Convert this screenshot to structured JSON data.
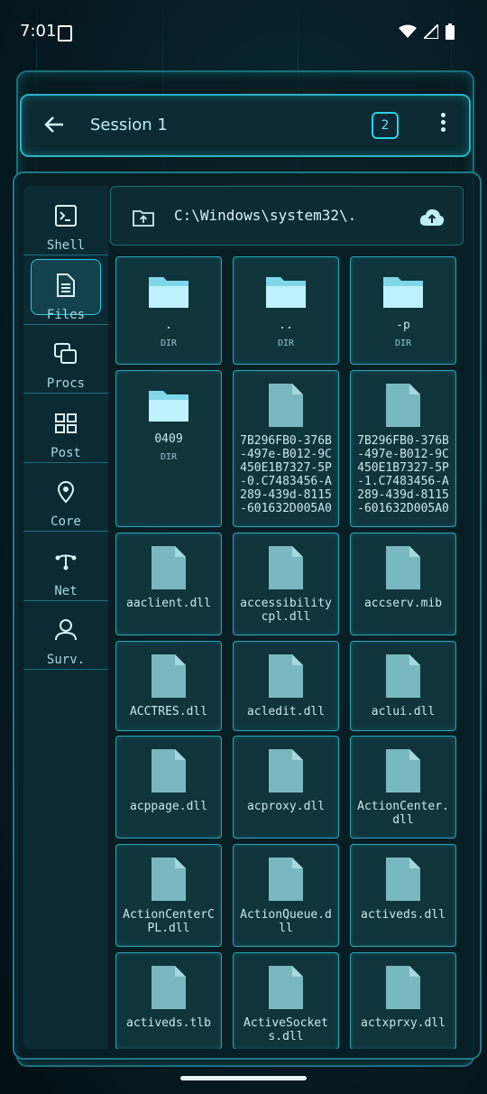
{
  "status": {
    "time": "7:01"
  },
  "header": {
    "title": "Session 1",
    "badge": "2"
  },
  "sidebar": [
    {
      "label": "Shell",
      "icon": "terminal-icon",
      "active": false
    },
    {
      "label": "Files",
      "icon": "document-icon",
      "active": true
    },
    {
      "label": "Procs",
      "icon": "processes-icon",
      "active": false
    },
    {
      "label": "Post",
      "icon": "grid-icon",
      "active": false
    },
    {
      "label": "Core",
      "icon": "location-pin-icon",
      "active": false
    },
    {
      "label": "Net",
      "icon": "network-icon",
      "active": false
    },
    {
      "label": "Surv.",
      "icon": "person-icon",
      "active": false
    }
  ],
  "path": {
    "value": "C:\\Windows\\system32\\."
  },
  "files": [
    {
      "name": ".",
      "kind": "DIR",
      "type": "folder"
    },
    {
      "name": "..",
      "kind": "DIR",
      "type": "folder"
    },
    {
      "name": "-p",
      "kind": "DIR",
      "type": "folder"
    },
    {
      "name": "0409",
      "kind": "DIR",
      "type": "folder"
    },
    {
      "name": "7B296FB0-376B-497e-B012-9C450E1B7327-5P-0.C7483456-A289-439d-8115-601632D005A0",
      "kind": "",
      "type": "file"
    },
    {
      "name": "7B296FB0-376B-497e-B012-9C450E1B7327-5P-1.C7483456-A289-439d-8115-601632D005A0",
      "kind": "",
      "type": "file"
    },
    {
      "name": "aaclient.dll",
      "kind": "",
      "type": "file"
    },
    {
      "name": "accessibilitycpl.dll",
      "kind": "",
      "type": "file"
    },
    {
      "name": "accserv.mib",
      "kind": "",
      "type": "file"
    },
    {
      "name": "ACCTRES.dll",
      "kind": "",
      "type": "file"
    },
    {
      "name": "acledit.dll",
      "kind": "",
      "type": "file"
    },
    {
      "name": "aclui.dll",
      "kind": "",
      "type": "file"
    },
    {
      "name": "acppage.dll",
      "kind": "",
      "type": "file"
    },
    {
      "name": "acproxy.dll",
      "kind": "",
      "type": "file"
    },
    {
      "name": "ActionCenter.dll",
      "kind": "",
      "type": "file"
    },
    {
      "name": "ActionCenterCPL.dll",
      "kind": "",
      "type": "file"
    },
    {
      "name": "ActionQueue.dll",
      "kind": "",
      "type": "file"
    },
    {
      "name": "activeds.dll",
      "kind": "",
      "type": "file"
    },
    {
      "name": "activeds.tlb",
      "kind": "",
      "type": "file"
    },
    {
      "name": "ActiveSockets.dll",
      "kind": "",
      "type": "file"
    },
    {
      "name": "actxprxy.dll",
      "kind": "",
      "type": "file"
    }
  ]
}
